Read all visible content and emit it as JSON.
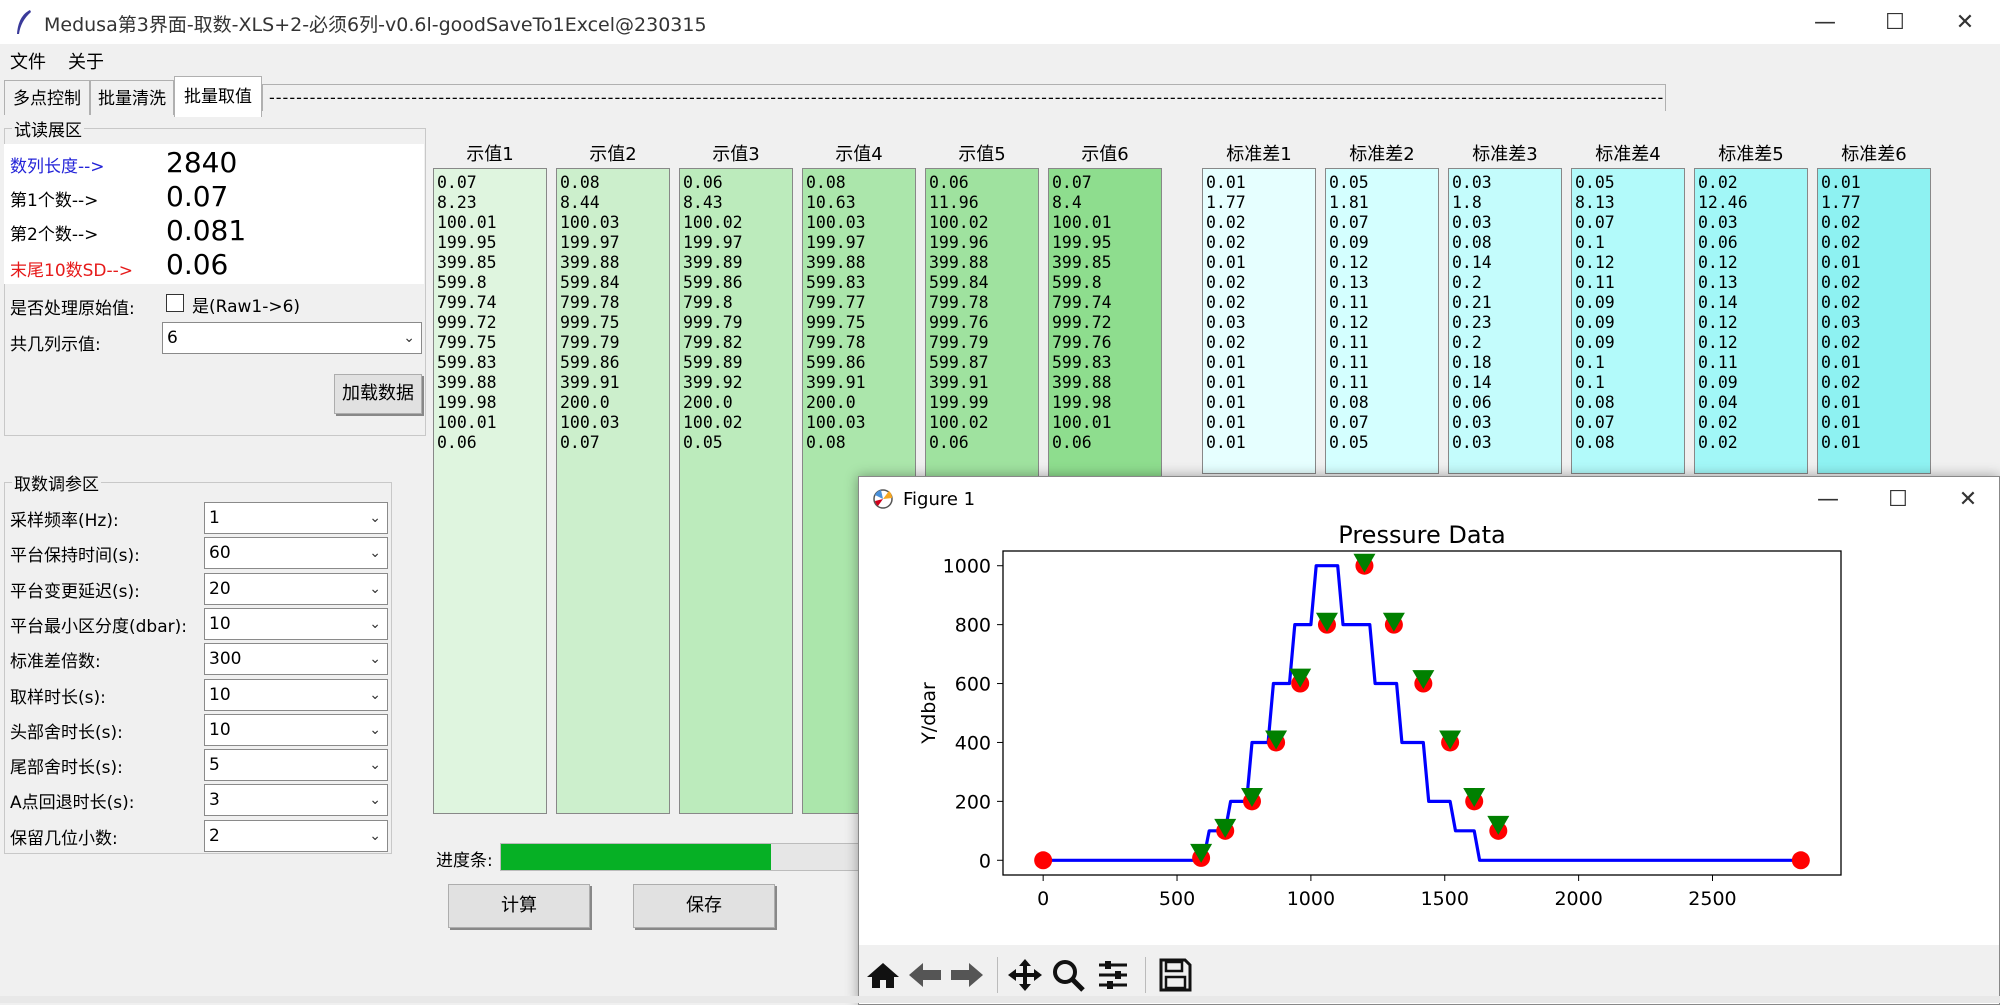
{
  "window": {
    "title": "Medusa第3界面-取数-XLS+2-必须6列-v0.6l-goodSaveTo1Excel@230315",
    "minimize_glyph": "—",
    "maximize_glyph": "☐",
    "close_glyph": "✕"
  },
  "menu": {
    "file": "文件",
    "about": "关于"
  },
  "tabs": [
    {
      "label": "多点控制"
    },
    {
      "label": "批量清洗"
    },
    {
      "label": "批量取值"
    }
  ],
  "tab_strip_text": "----------------------------------------------------------------------------------------------------------------------------------------------------------------------------------------------------------------------------------------",
  "preview": {
    "group_title": "试读展区",
    "seq_len_label": "数列长度-->",
    "seq_len_value": "2840",
    "first_label": "第1个数-->",
    "first_value": "0.07",
    "second_label": "第2个数-->",
    "second_value": "0.081",
    "tail_sd_label": "末尾10数SD-->",
    "tail_sd_value": "0.06",
    "process_raw_label": "是否处理原始值:",
    "process_raw_checkbox": "是(Raw1->6)",
    "columns_label": "共几列示值:",
    "columns_value": "6",
    "load_button": "加载数据"
  },
  "params": {
    "group_title": "取数调参区",
    "rows": [
      {
        "label": "采样频率(Hz):",
        "value": "1"
      },
      {
        "label": "平台保持时间(s):",
        "value": "60"
      },
      {
        "label": "平台变更延迟(s):",
        "value": "20"
      },
      {
        "label": "平台最小区分度(dbar):",
        "value": "10"
      },
      {
        "label": "标准差倍数:",
        "value": "300"
      },
      {
        "label": "取样时长(s):",
        "value": "10"
      },
      {
        "label": "头部舍时长(s):",
        "value": "10"
      },
      {
        "label": "尾部舍时长(s):",
        "value": "5"
      },
      {
        "label": "A点回退时长(s):",
        "value": "3"
      },
      {
        "label": "保留几位小数:",
        "value": "2"
      }
    ]
  },
  "value_columns": [
    {
      "header": "示值1",
      "text": "0.07\n8.23\n100.01\n199.95\n399.85\n599.8\n799.74\n999.72\n799.75\n599.83\n399.88\n199.98\n100.01\n0.06"
    },
    {
      "header": "示值2",
      "text": "0.08\n8.44\n100.03\n199.97\n399.88\n599.84\n799.78\n999.75\n799.79\n599.86\n399.91\n200.0\n100.03\n0.07"
    },
    {
      "header": "示值3",
      "text": "0.06\n8.43\n100.02\n199.97\n399.89\n599.86\n799.8\n999.79\n799.82\n599.89\n399.92\n200.0\n100.02\n0.05"
    },
    {
      "header": "示值4",
      "text": "0.08\n10.63\n100.03\n199.97\n399.88\n599.83\n799.77\n999.75\n799.78\n599.86\n399.91\n200.0\n100.03\n0.08"
    },
    {
      "header": "示值5",
      "text": "0.06\n11.96\n100.02\n199.96\n399.88\n599.84\n799.78\n999.76\n799.79\n599.87\n399.91\n199.99\n100.02\n0.06"
    },
    {
      "header": "示值6",
      "text": "0.07\n8.4\n100.01\n199.95\n399.85\n599.8\n799.74\n999.72\n799.76\n599.83\n399.88\n199.98\n100.01\n0.06"
    }
  ],
  "sd_columns": [
    {
      "header": "标准差1",
      "text": "0.01\n1.77\n0.02\n0.02\n0.01\n0.02\n0.02\n0.03\n0.02\n0.01\n0.01\n0.01\n0.01\n0.01"
    },
    {
      "header": "标准差2",
      "text": "0.05\n1.81\n0.07\n0.09\n0.12\n0.13\n0.11\n0.12\n0.11\n0.11\n0.11\n0.08\n0.07\n0.05"
    },
    {
      "header": "标准差3",
      "text": "0.03\n1.8\n0.03\n0.08\n0.14\n0.2\n0.21\n0.23\n0.2\n0.18\n0.14\n0.06\n0.03\n0.03"
    },
    {
      "header": "标准差4",
      "text": "0.05\n8.13\n0.07\n0.1\n0.12\n0.11\n0.09\n0.09\n0.09\n0.1\n0.1\n0.08\n0.07\n0.08"
    },
    {
      "header": "标准差5",
      "text": "0.02\n12.46\n0.03\n0.06\n0.12\n0.13\n0.14\n0.12\n0.12\n0.11\n0.09\n0.04\n0.02\n0.02"
    },
    {
      "header": "标准差6",
      "text": "0.01\n1.77\n0.02\n0.02\n0.01\n0.02\n0.02\n0.03\n0.02\n0.01\n0.02\n0.01\n0.01\n0.01"
    }
  ],
  "value_colors": [
    "#dff5df",
    "#ccefcc",
    "#bcebbc",
    "#abe6ab",
    "#9fe29f",
    "#8edd8e"
  ],
  "sd_colors": [
    "#e6ffff",
    "#d4ffff",
    "#c4fcfc",
    "#b2fafa",
    "#a2f7f7",
    "#8ef2f2"
  ],
  "progress": {
    "label": "进度条:",
    "fraction": 0.75,
    "color": "#06b025"
  },
  "actions": {
    "compute": "计算",
    "save": "保存"
  },
  "figure": {
    "window_title": "Figure 1",
    "toolbar_icons": [
      "home-icon",
      "back-arrow-icon",
      "forward-arrow-icon",
      "pan-icon",
      "zoom-icon",
      "configure-subplots-icon",
      "save-icon"
    ],
    "chart_data": {
      "type": "line",
      "title": "Pressure Data",
      "xlabel": "",
      "ylabel": "Y/dbar",
      "xlim": [
        -150,
        2980
      ],
      "ylim": [
        -50,
        1050
      ],
      "xticks": [
        0,
        500,
        1000,
        1500,
        2000,
        2500
      ],
      "yticks": [
        0,
        200,
        400,
        600,
        800,
        1000
      ],
      "series": [
        {
          "color": "#0000ff",
          "x": [
            0,
            585,
            600,
            620,
            640,
            680,
            700,
            720,
            760,
            780,
            800,
            840,
            860,
            880,
            920,
            940,
            960,
            1000,
            1020,
            1040,
            1080,
            1100,
            1120,
            1200,
            1220,
            1240,
            1300,
            1320,
            1340,
            1400,
            1420,
            1440,
            1500,
            1520,
            1540,
            1590,
            1610,
            1630,
            1680,
            1700,
            1720,
            2840
          ],
          "y": [
            0,
            0,
            8,
            100,
            100,
            100,
            200,
            200,
            200,
            400,
            400,
            400,
            600,
            600,
            600,
            800,
            800,
            800,
            1000,
            1000,
            1000,
            1000,
            800,
            800,
            800,
            600,
            600,
            600,
            400,
            400,
            400,
            200,
            200,
            200,
            100,
            100,
            100,
            0,
            0,
            0,
            0,
            0
          ]
        }
      ],
      "red_markers": [
        [
          0,
          0
        ],
        [
          590,
          8
        ],
        [
          680,
          100
        ],
        [
          780,
          200
        ],
        [
          870,
          400
        ],
        [
          960,
          600
        ],
        [
          1060,
          800
        ],
        [
          1200,
          1000
        ],
        [
          1310,
          800
        ],
        [
          1420,
          600
        ],
        [
          1520,
          400
        ],
        [
          1610,
          200
        ],
        [
          1700,
          100
        ],
        [
          2830,
          0
        ]
      ],
      "green_markers": [
        [
          590,
          25
        ],
        [
          680,
          110
        ],
        [
          780,
          215
        ],
        [
          870,
          410
        ],
        [
          960,
          620
        ],
        [
          1060,
          810
        ],
        [
          1200,
          1010
        ],
        [
          1310,
          810
        ],
        [
          1420,
          615
        ],
        [
          1520,
          410
        ],
        [
          1610,
          215
        ],
        [
          1700,
          120
        ]
      ],
      "marker_colors": {
        "red": "#ff0000",
        "green": "#008000"
      }
    }
  }
}
